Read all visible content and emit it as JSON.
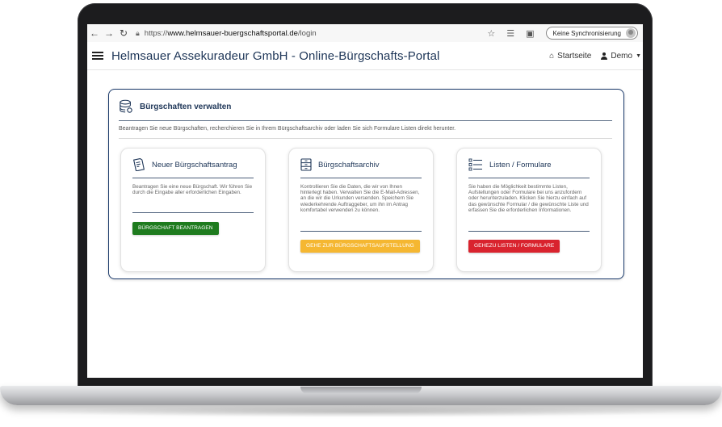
{
  "browser": {
    "url_prefix": "https://",
    "url_host": "www.helmsauer-buergschaftsportal.de",
    "url_path": "/login",
    "sync_label": "Keine Synchronisierung"
  },
  "header": {
    "title": "Helmsauer Assekuradeur GmbH - Online-Bürgschafts-Portal",
    "home_label": "Startseite",
    "user_label": "Demo"
  },
  "panel": {
    "title": "Bürgschaften verwalten",
    "description": "Beantragen Sie neue Bürgschaften, recherchieren Sie in Ihrem Bürgschaftsarchiv oder laden Sie sich Formulare Listen direkt herunter."
  },
  "cards": [
    {
      "title": "Neuer Bürgschaftsantrag",
      "text": "Beantragen Sie eine neue Bürgschaft. Wir führen Sie durch die Eingabe aller erforderlichen Eingaben.",
      "button": "BÜRGSCHAFT BEANTRAGEN",
      "button_color": "#1e7b1e"
    },
    {
      "title": "Bürgschaftsarchiv",
      "text": "Kontrollieren Sie die Daten, die wir von Ihnen hinterlegt haben. Verwalten Sie die E-Mail-Adressen, an die wir die Urkunden versenden. Speichern Sie wiederkehrende Auftraggeber, um ihn im Antrag komfortabel verwenden zu können.",
      "button": "GEHE ZUR BÜRGSCHAFTSAUFSTELLUNG",
      "button_color": "#f5b731"
    },
    {
      "title": "Listen / Formulare",
      "text": "Sie haben die Möglichkeit bestimmte Listen, Aufstellungen oder Formulare bei uns anzufordern oder herunterzuladen. Klicken Sie hierzu einfach auf das gewünschte Formular / die gewünschte Liste und erfassen Sie die erforderlichen Informationen.",
      "button": "GEHEZU LISTEN / FORMULARE",
      "button_color": "#d9232e"
    }
  ],
  "colors": {
    "brand_navy": "#1d3557",
    "panel_border": "#1b3a6b"
  }
}
